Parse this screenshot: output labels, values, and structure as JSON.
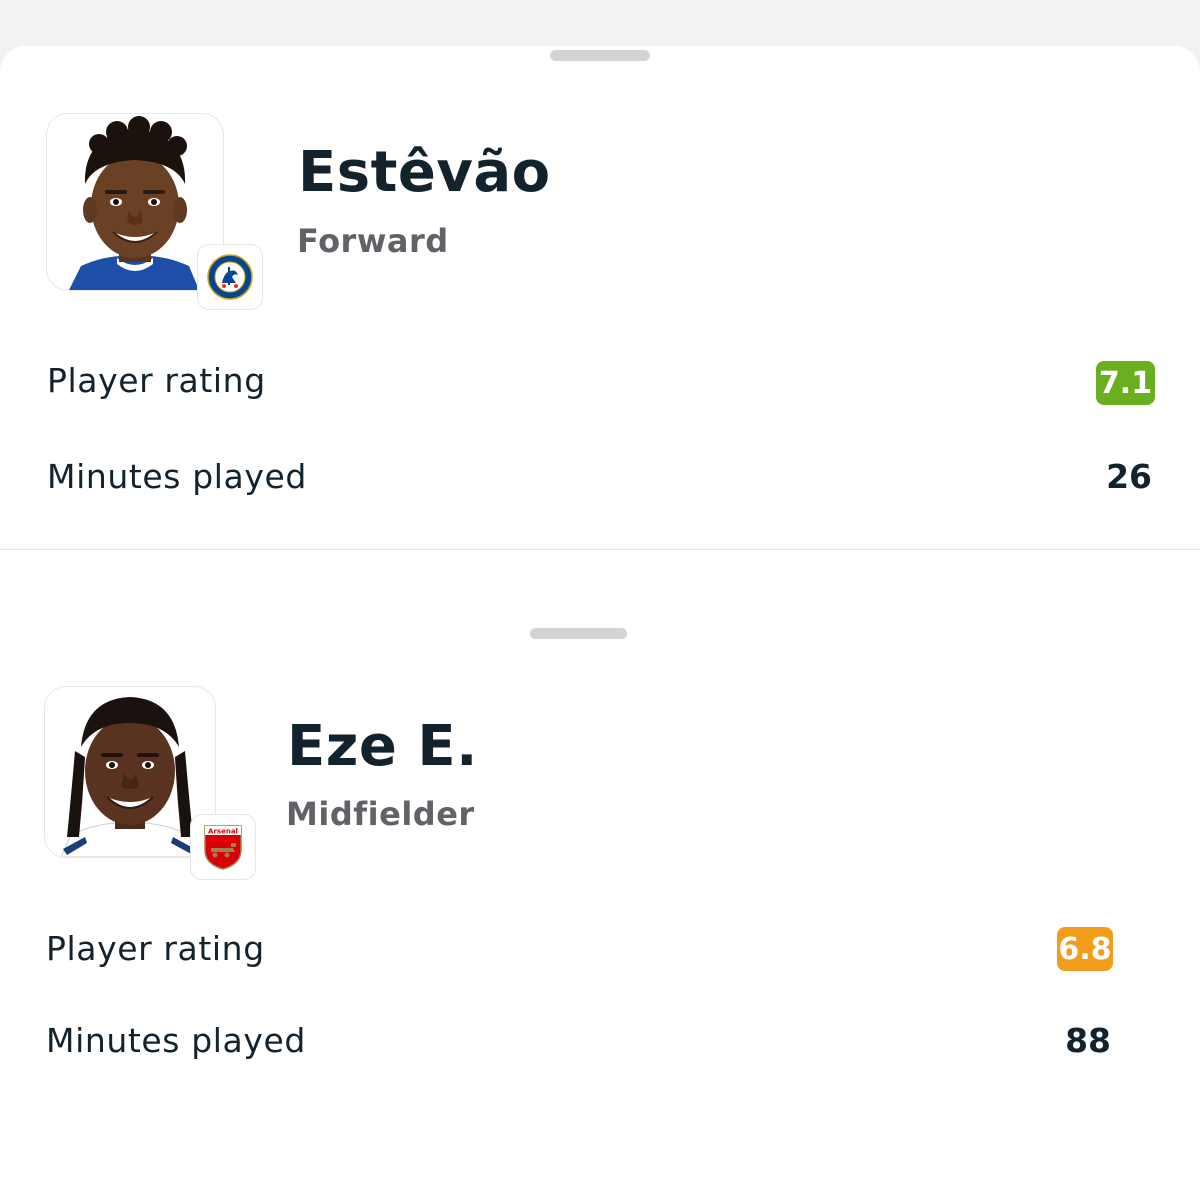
{
  "players": [
    {
      "name": "Estêvão",
      "position": "Forward",
      "club_badge_icon": "chelsea-crest-icon",
      "stats": {
        "rating_label": "Player rating",
        "rating_value": "7.1",
        "rating_color": "#6aaf1f",
        "minutes_label": "Minutes played",
        "minutes_value": "26"
      }
    },
    {
      "name": "Eze E.",
      "position": "Midfielder",
      "club_badge_icon": "arsenal-crest-icon",
      "stats": {
        "rating_label": "Player rating",
        "rating_value": "6.8",
        "rating_color": "#f29d1b",
        "minutes_label": "Minutes played",
        "minutes_value": "88"
      }
    }
  ],
  "colors": {
    "text_primary": "#12232e",
    "text_secondary": "#5f6368",
    "handle": "#d3d3d3"
  }
}
